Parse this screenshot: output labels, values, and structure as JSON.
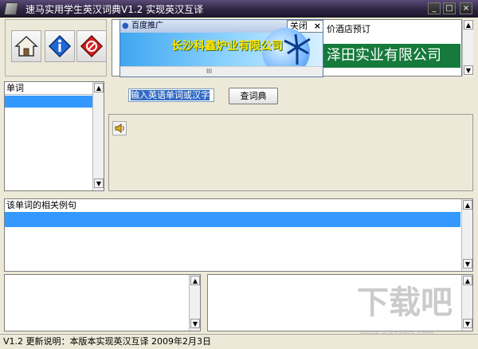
{
  "window": {
    "title": "速马实用学生英汉词典V1.2 实现英汉互译",
    "minimize_label": "_",
    "maximize_label": "□",
    "close_label": "×"
  },
  "ad": {
    "title": "百度推广",
    "close_label": "关闭",
    "close_x": "×",
    "company": "长沙科鑫炉业有限公司",
    "scroll_thumb": "III",
    "hotel_link": "价酒店预订",
    "green_banner": "泽田实业有限公司"
  },
  "word_list": {
    "header": "单词"
  },
  "search": {
    "value": "输入英语单词或汉字",
    "button_label": "查词典"
  },
  "examples": {
    "header": "该单词的相关例句"
  },
  "status": {
    "text": "V1.2  更新说明：本版本实现英汉互译 2009年2月3日"
  },
  "watermark": {
    "text": "下载吧",
    "url": "www.xiazaiba.com"
  },
  "colors": {
    "selection": "#3399ff",
    "titlebar": "#2d2440",
    "ad_green": "#157a3b"
  },
  "icons": {
    "toolbar": [
      "home-icon",
      "info-icon",
      "stop-icon"
    ],
    "speaker": "speaker-icon"
  }
}
